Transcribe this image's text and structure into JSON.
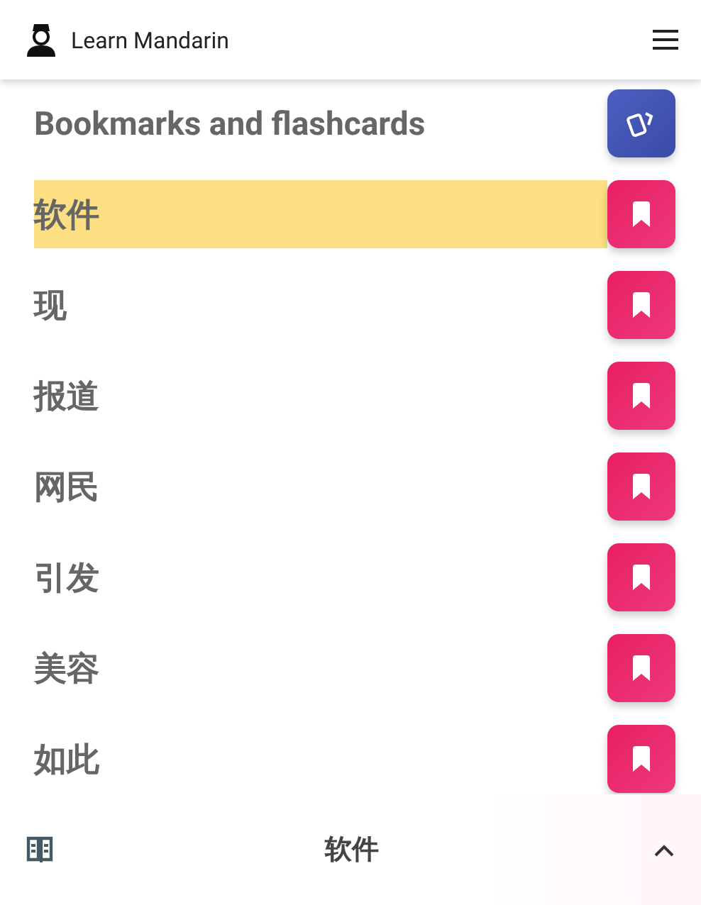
{
  "app_bar": {
    "title": "Learn Mandarin"
  },
  "heading": "Bookmarks and flashcards",
  "words": [
    {
      "text": "软件",
      "selected": true
    },
    {
      "text": "现",
      "selected": false
    },
    {
      "text": "报道",
      "selected": false
    },
    {
      "text": "网民",
      "selected": false
    },
    {
      "text": "引发",
      "selected": false
    },
    {
      "text": "美容",
      "selected": false
    },
    {
      "text": "如此",
      "selected": false
    }
  ],
  "bottom_bar": {
    "current_word": "软件"
  }
}
